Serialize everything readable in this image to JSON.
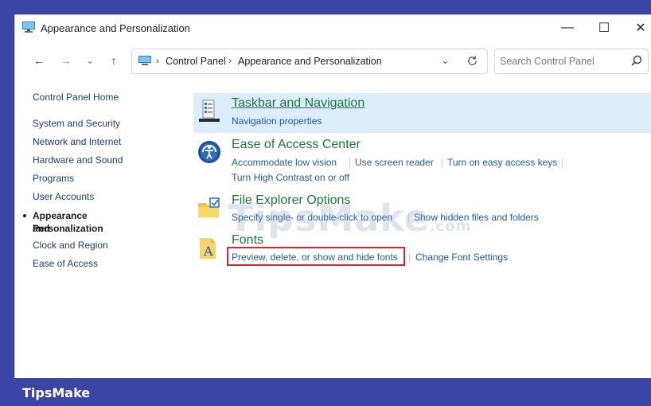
{
  "window": {
    "title": "Appearance and Personalization",
    "controls": {
      "minimize": "—",
      "maximize": "☐",
      "close": "✕"
    }
  },
  "navbar": {
    "back": "←",
    "forward": "→",
    "recent": "⌄",
    "up": "↑",
    "breadcrumb": [
      "Control Panel",
      "Appearance and Personalization"
    ],
    "search_placeholder": "Search Control Panel"
  },
  "sidebar": {
    "items": [
      {
        "label": "Control Panel Home"
      },
      {
        "label": "System and Security"
      },
      {
        "label": "Network and Internet"
      },
      {
        "label": "Hardware and Sound"
      },
      {
        "label": "Programs"
      },
      {
        "label": "User Accounts"
      },
      {
        "label": "Appearance and",
        "label2": "Personalization"
      },
      {
        "label": "Clock and Region"
      },
      {
        "label": "Ease of Access"
      }
    ]
  },
  "categories": [
    {
      "title": "Taskbar and Navigation",
      "links": [
        "Navigation properties"
      ]
    },
    {
      "title": "Ease of Access Center",
      "links": [
        "Accommodate low vision",
        "Use screen reader",
        "Turn on easy access keys",
        "Turn High Contrast on or off"
      ]
    },
    {
      "title": "File Explorer Options",
      "links": [
        "Specify single- or double-click to open",
        "Show hidden files and folders"
      ]
    },
    {
      "title": "Fonts",
      "links": [
        "Preview, delete, or show and hide fonts",
        "Change Font Settings"
      ]
    }
  ],
  "watermark": {
    "text": "TipsMake",
    "suffix": ".com"
  },
  "footer": {
    "brand": "TipsMake"
  },
  "colors": {
    "accent": "#3b45a6",
    "highlight": "#dceefb",
    "link": "#1f5aa6",
    "title_green": "#1a7a3a",
    "red_box": "#d9262f"
  }
}
